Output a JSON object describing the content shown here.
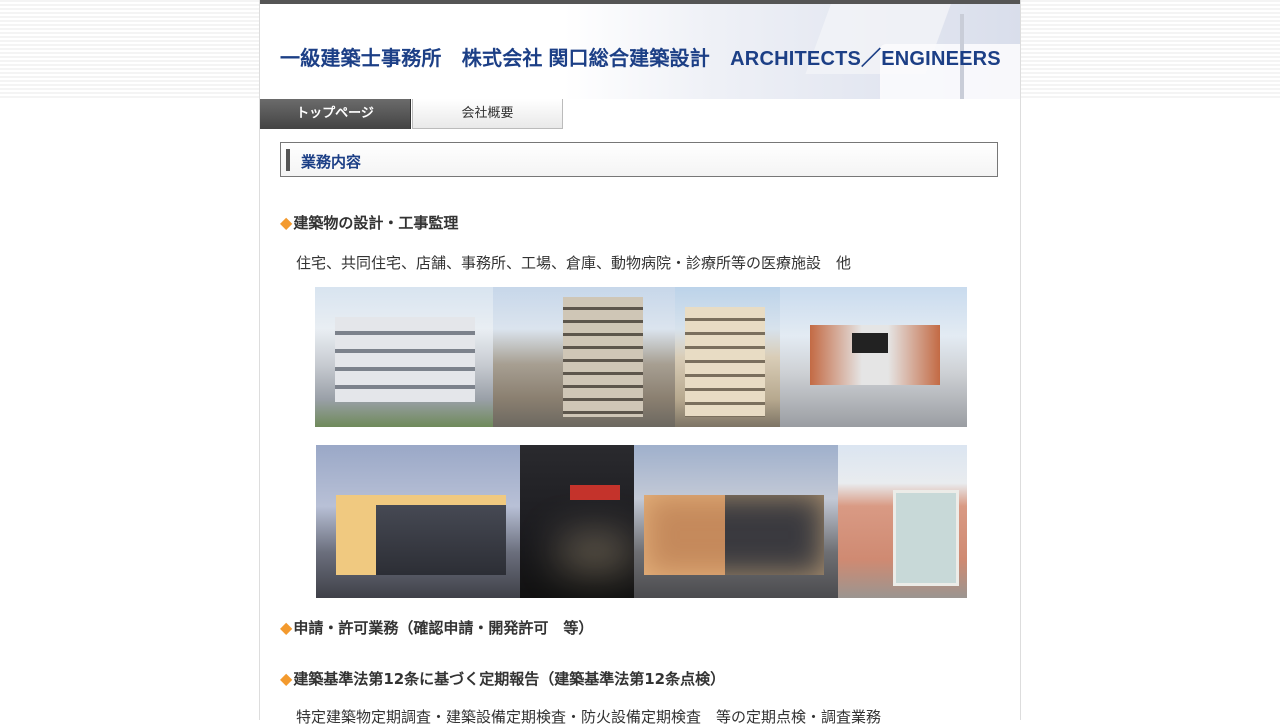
{
  "header": {
    "title": "一級建築士事務所　株式会社 関口総合建築設計　ARCHITECTS／ENGINEERS"
  },
  "nav": {
    "tabs": [
      {
        "label": "トップページ",
        "active": true
      },
      {
        "label": "会社概要",
        "active": false
      }
    ]
  },
  "main": {
    "section_heading": "業務内容",
    "bullet_icon": "◆",
    "items": [
      {
        "title": "建築物の設計・工事監理",
        "desc": "住宅、共同住宅、店舗、事務所、工場、倉庫、動物病院・診療所等の医療施設　他"
      },
      {
        "title": "申請・許可業務（確認申請・開発許可　等）",
        "desc": ""
      },
      {
        "title": "建築基準法第12条に基づく定期報告（建築基準法第12条点検）",
        "desc": "特定建築物定期調査・建築設備定期検査・防火設備定期検査　等の定期点検・調査業務"
      }
    ]
  },
  "colors": {
    "accent_title": "#1c3f86",
    "bullet": "#f39a2e",
    "tab_active_bg": "#555555"
  }
}
